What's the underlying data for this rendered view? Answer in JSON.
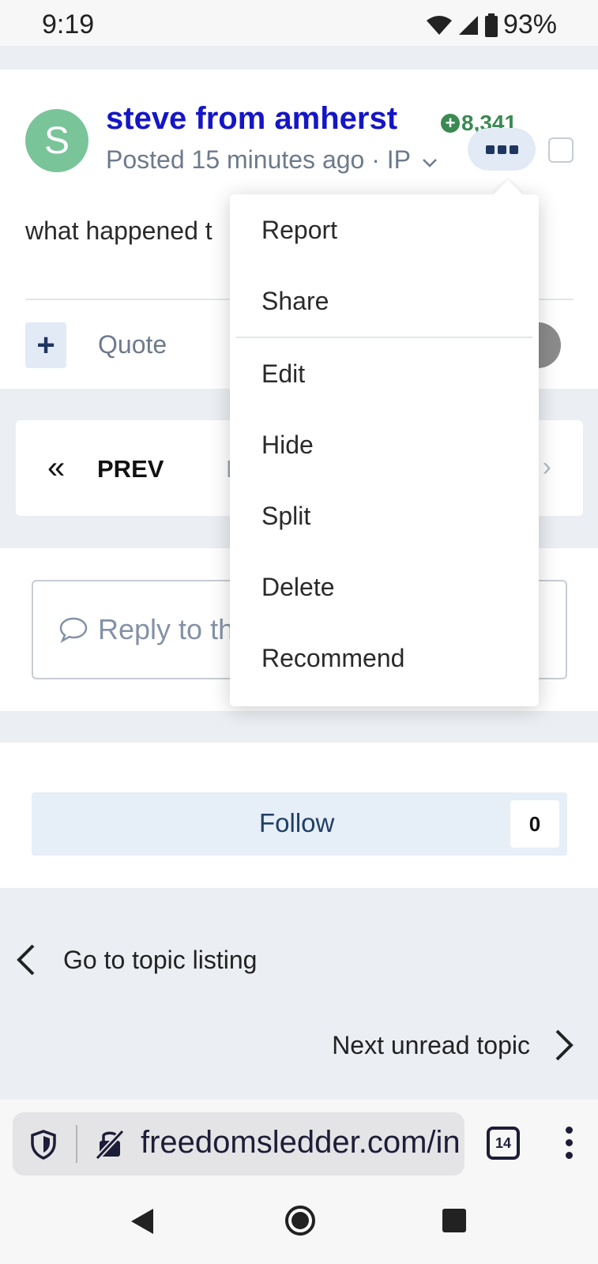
{
  "status_bar": {
    "time": "9:19",
    "battery": "93%"
  },
  "post": {
    "avatar_letter": "S",
    "author": "steve from amherst",
    "reputation": "8,341",
    "meta": "Posted 15 minutes ago · IP",
    "body": "what happened t",
    "quote_label": "Quote"
  },
  "menu": {
    "items_top": [
      "Report",
      "Share"
    ],
    "items_bottom": [
      "Edit",
      "Hide",
      "Split",
      "Delete",
      "Recommend"
    ]
  },
  "pagination": {
    "prev_label": "PREV",
    "page_fragment": "P"
  },
  "reply": {
    "placeholder": "Reply to th"
  },
  "follow": {
    "label": "Follow",
    "count": "0"
  },
  "navigation": {
    "go_to_listing": "Go to topic listing",
    "next_unread": "Next unread topic"
  },
  "browser": {
    "url": "freedomsledder.com/in",
    "tab_count": "14"
  }
}
